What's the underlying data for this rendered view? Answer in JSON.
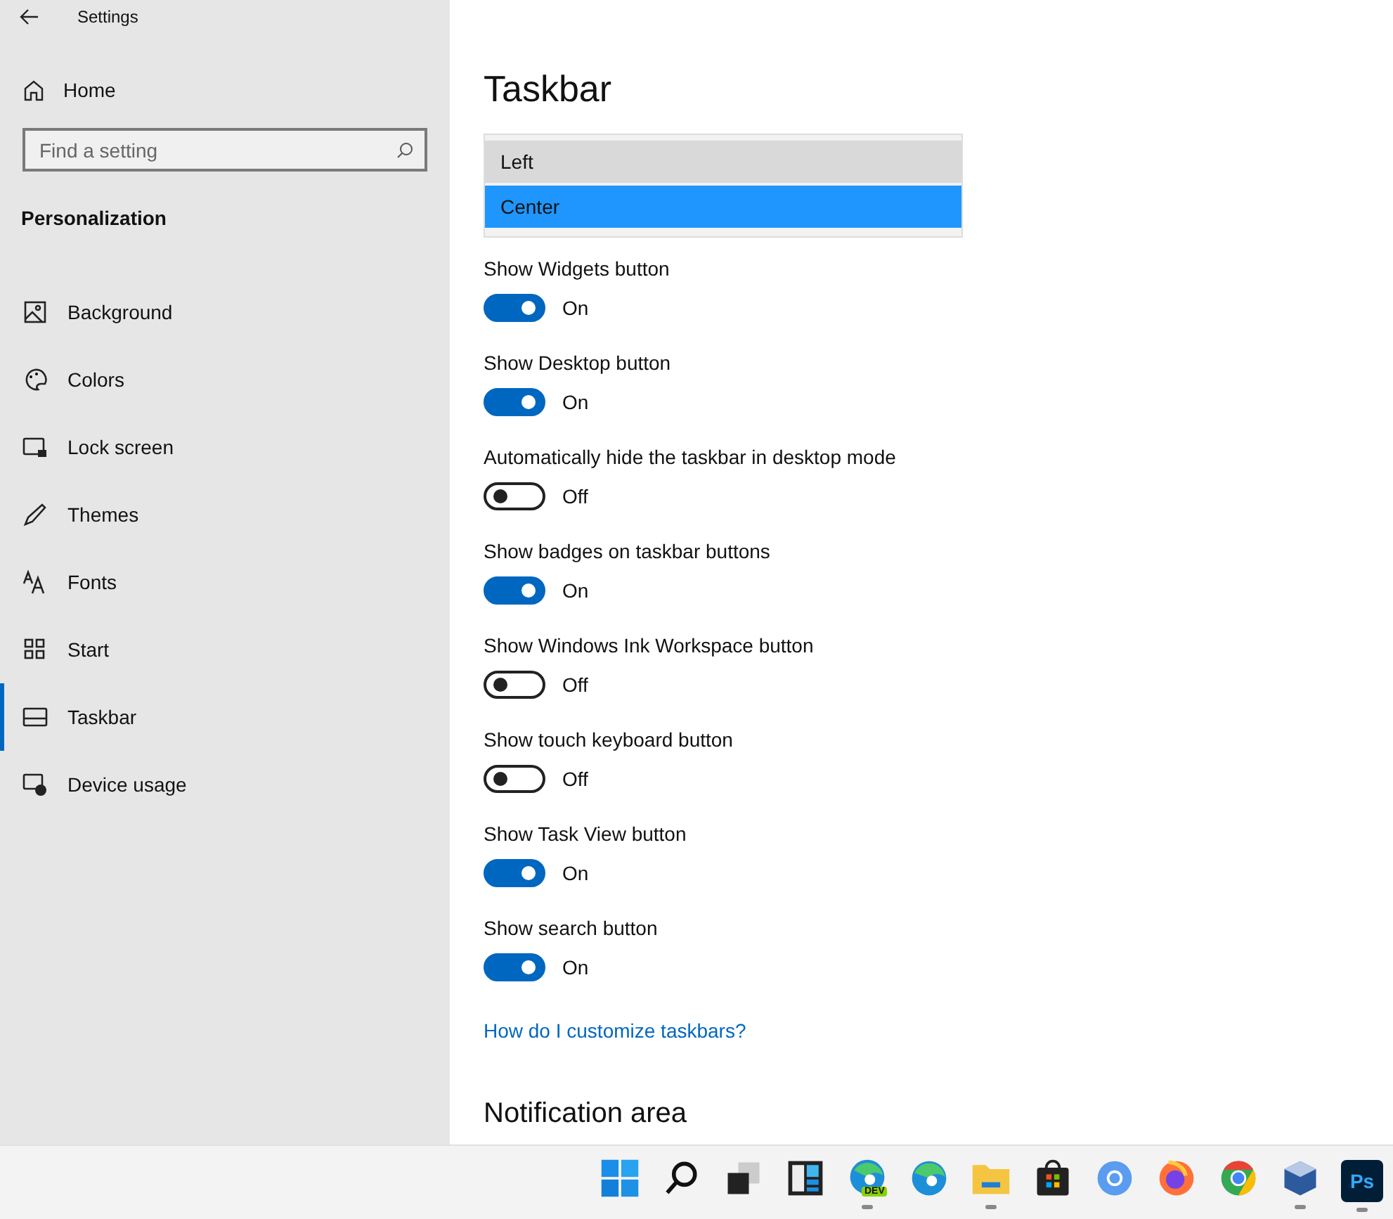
{
  "window": {
    "title": "Settings"
  },
  "sidebar": {
    "home": "Home",
    "search": {
      "placeholder": "Find a setting"
    },
    "section": "Personalization",
    "items": [
      {
        "kind": "background",
        "label": "Background",
        "selected": false
      },
      {
        "kind": "colors",
        "label": "Colors",
        "selected": false
      },
      {
        "kind": "lock",
        "label": "Lock screen",
        "selected": false
      },
      {
        "kind": "themes",
        "label": "Themes",
        "selected": false
      },
      {
        "kind": "fonts",
        "label": "Fonts",
        "selected": false
      },
      {
        "kind": "start",
        "label": "Start",
        "selected": false
      },
      {
        "kind": "taskbar",
        "label": "Taskbar",
        "selected": true
      },
      {
        "kind": "device",
        "label": "Device usage",
        "selected": false
      }
    ]
  },
  "content": {
    "title": "Taskbar",
    "dropdown": [
      {
        "label": "Left",
        "selected": false,
        "hovered": true
      },
      {
        "label": "Center",
        "selected": true,
        "hovered": false
      }
    ],
    "toggles": [
      {
        "label": "Show Widgets button",
        "on": true,
        "state": "On"
      },
      {
        "label": "Show Desktop button",
        "on": true,
        "state": "On"
      },
      {
        "label": "Automatically hide the taskbar in desktop mode",
        "on": false,
        "state": "Off"
      },
      {
        "label": "Show badges on taskbar buttons",
        "on": true,
        "state": "On"
      },
      {
        "label": "Show Windows Ink Workspace button",
        "on": false,
        "state": "Off"
      },
      {
        "label": "Show touch keyboard button",
        "on": false,
        "state": "Off"
      },
      {
        "label": "Show Task View button",
        "on": true,
        "state": "On"
      },
      {
        "label": "Show search button",
        "on": true,
        "state": "On"
      }
    ],
    "link": "How do I customize taskbars?",
    "next_section": "Notification area"
  },
  "taskbar": {
    "apps": [
      {
        "kind": "start",
        "running": false
      },
      {
        "kind": "search",
        "running": false
      },
      {
        "kind": "taskview",
        "running": false
      },
      {
        "kind": "widgets",
        "running": false
      },
      {
        "kind": "edge-dev",
        "label": "DEV",
        "running": true
      },
      {
        "kind": "edge",
        "running": false
      },
      {
        "kind": "explorer",
        "running": true
      },
      {
        "kind": "store",
        "running": false
      },
      {
        "kind": "chromium",
        "running": false
      },
      {
        "kind": "firefox",
        "running": false
      },
      {
        "kind": "chrome",
        "running": false
      },
      {
        "kind": "virtualbox",
        "running": true
      },
      {
        "kind": "photoshop",
        "label": "Ps",
        "running": true
      }
    ]
  }
}
